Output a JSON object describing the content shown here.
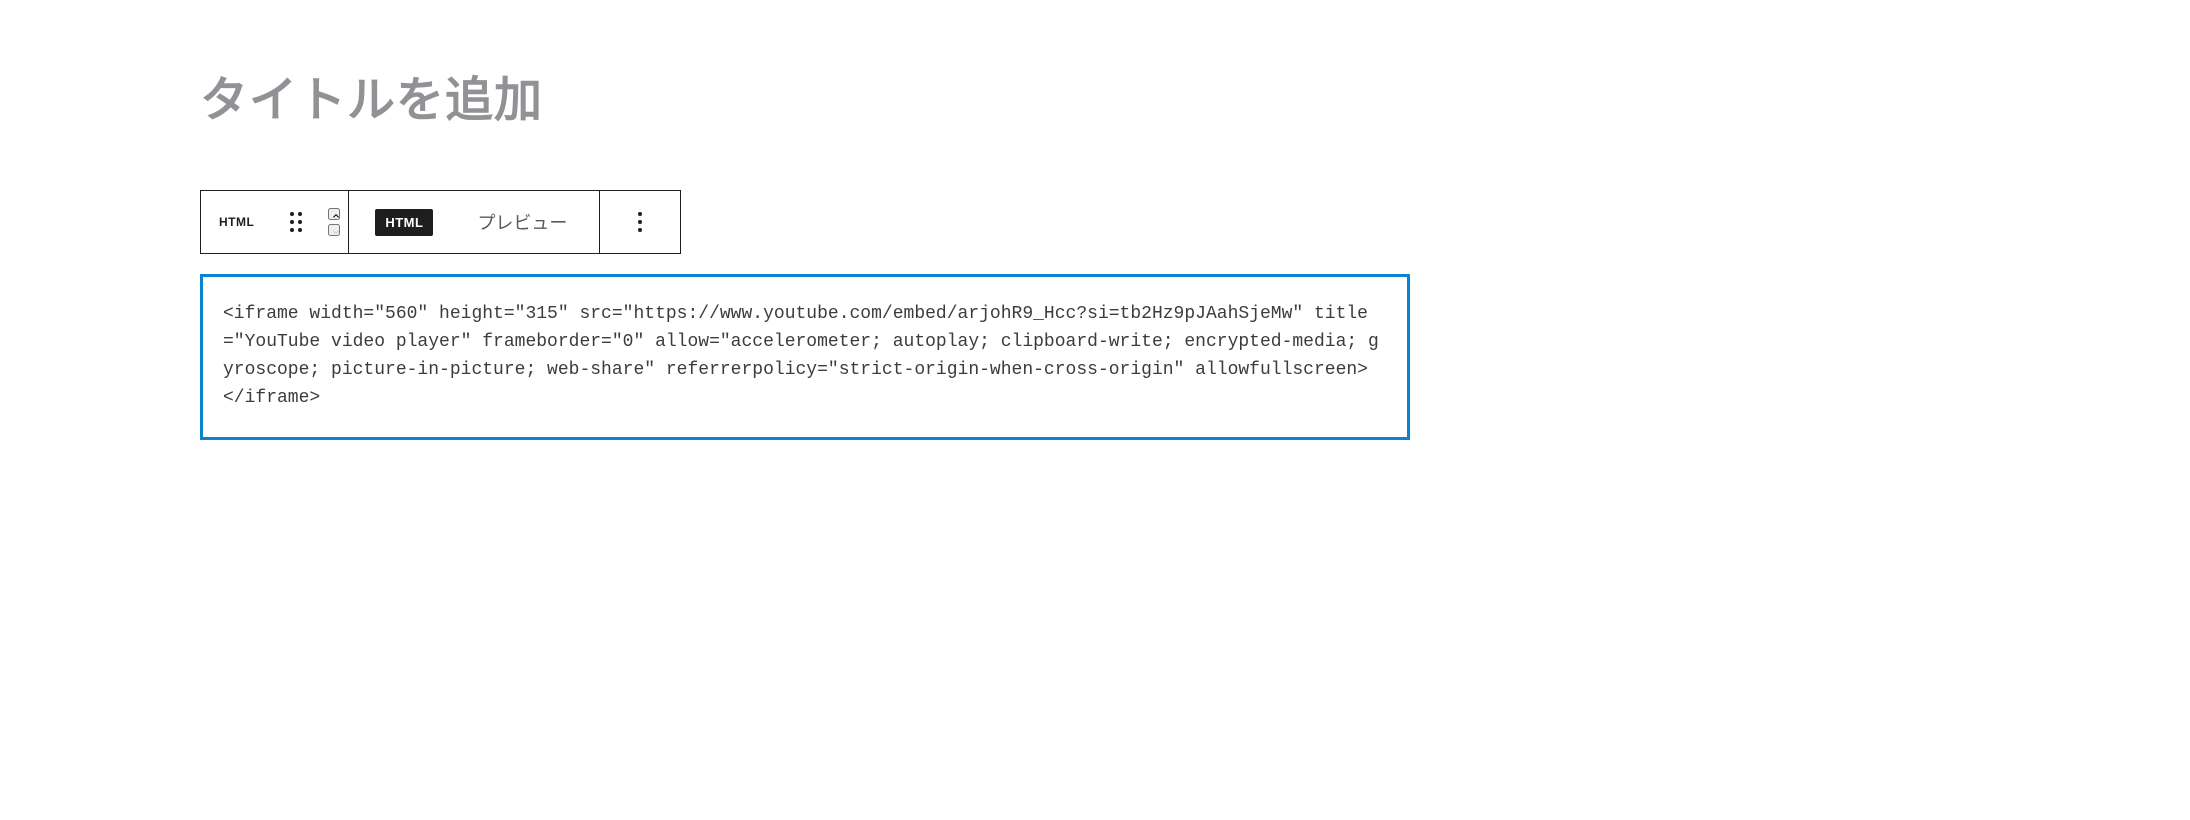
{
  "title": {
    "placeholder": "タイトルを追加"
  },
  "toolbar": {
    "block_type_label": "HTML",
    "html_badge": "HTML",
    "preview_label": "プレビュー"
  },
  "html_block": {
    "content": "<iframe width=\"560\" height=\"315\" src=\"https://www.youtube.com/embed/arjohR9_Hcc?si=tb2Hz9pJAahSjeMw\" title=\"YouTube video player\" frameborder=\"0\" allow=\"accelerometer; autoplay; clipboard-write; encrypted-media; gyroscope; picture-in-picture; web-share\" referrerpolicy=\"strict-origin-when-cross-origin\" allowfullscreen></iframe>"
  }
}
